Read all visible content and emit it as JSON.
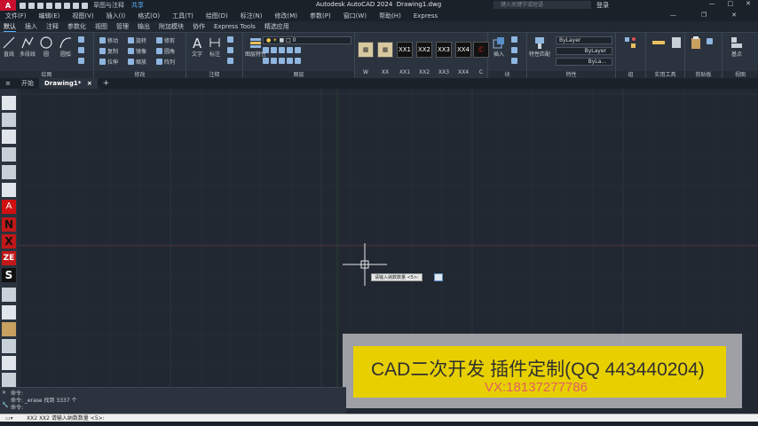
{
  "titlebar": {
    "app_letter": "A",
    "workspace": "草图与注释",
    "share": "共享",
    "title": "Autodesk AutoCAD 2024",
    "document": "Drawing1.dwg",
    "search_placeholder": "键入关键字或短语",
    "login": "登录"
  },
  "menubar": {
    "items": [
      "文件(F)",
      "编辑(E)",
      "视图(V)",
      "插入(I)",
      "格式(O)",
      "工具(T)",
      "绘图(D)",
      "标注(N)",
      "修改(M)",
      "参数(P)",
      "窗口(W)",
      "帮助(H)",
      "Express"
    ]
  },
  "ribbon_tabs": [
    "默认",
    "插入",
    "注释",
    "参数化",
    "视图",
    "管理",
    "输出",
    "附加模块",
    "协作",
    "Express Tools",
    "精选应用"
  ],
  "ribbon": {
    "draw": {
      "title": "绘图",
      "line": "直线",
      "polyline": "多段线",
      "circle": "圆",
      "arc": "圆弧"
    },
    "modify": {
      "title": "修改",
      "move": "移动",
      "rotate": "旋转",
      "trim": "修剪",
      "copy": "复制",
      "mirror": "镜像",
      "fillet": "圆角",
      "stretch": "拉伸",
      "scale": "缩放",
      "array": "阵列"
    },
    "annotation": {
      "title": "注释",
      "text": "文字",
      "dimension": "标注"
    },
    "layers": {
      "title": "图层",
      "layer_props": "图层特性",
      "current_layer": "0"
    },
    "custom": {
      "labels": [
        "W",
        "XX",
        "XX1",
        "XX2",
        "XX3",
        "XX4",
        "C"
      ]
    },
    "block": {
      "title": "块",
      "insert": "插入"
    },
    "properties": {
      "title": "特性",
      "match": "特性匹配",
      "bylayer": "ByLayer",
      "bylayer2": "ByLayer",
      "bylayer3": "ByLa..."
    },
    "groups": {
      "title": "组"
    },
    "utilities": {
      "title": "实用工具"
    },
    "clipboard": {
      "title": "剪贴板"
    },
    "view": {
      "title": "视图",
      "base": "基点"
    }
  },
  "doc_tabs": {
    "start": "开始",
    "drawing": "Drawing1*"
  },
  "canvas": {
    "tooltip": "请输入纳数数量 <5>:"
  },
  "banner": {
    "main": "CAD二次开发 插件定制(QQ 443440204)",
    "sub": "VX:18137277786"
  },
  "command": {
    "history": [
      "命令:",
      "命令: _erase 找到 3337 个",
      "命令:"
    ],
    "prompt": "XX2 XX2 请输入纳数数量 <5>:"
  }
}
